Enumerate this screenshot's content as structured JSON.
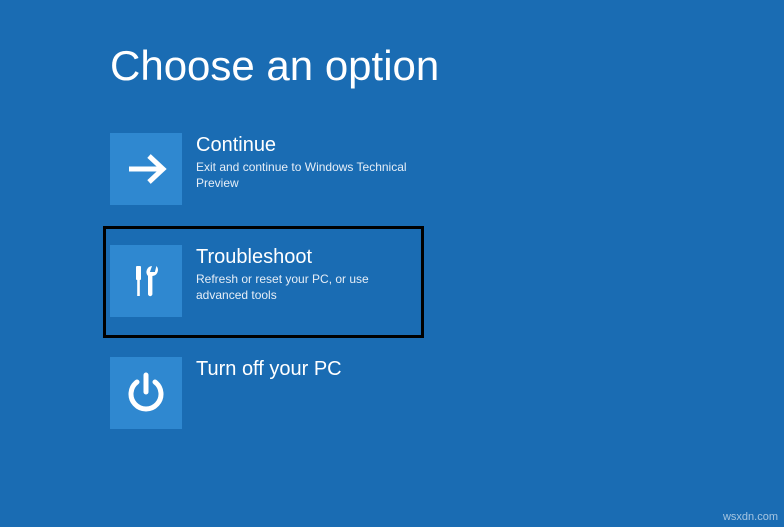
{
  "page_title": "Choose an option",
  "options": [
    {
      "title": "Continue",
      "description": "Exit and continue to Windows Technical Preview",
      "icon": "arrow-right-icon"
    },
    {
      "title": "Troubleshoot",
      "description": "Refresh or reset your PC, or use advanced tools",
      "icon": "tools-icon"
    },
    {
      "title": "Turn off your PC",
      "description": "",
      "icon": "power-icon"
    }
  ],
  "watermark": "wsxdn.com",
  "colors": {
    "background": "#1a6cb3",
    "tile": "#2f88d0",
    "text": "#ffffff"
  }
}
